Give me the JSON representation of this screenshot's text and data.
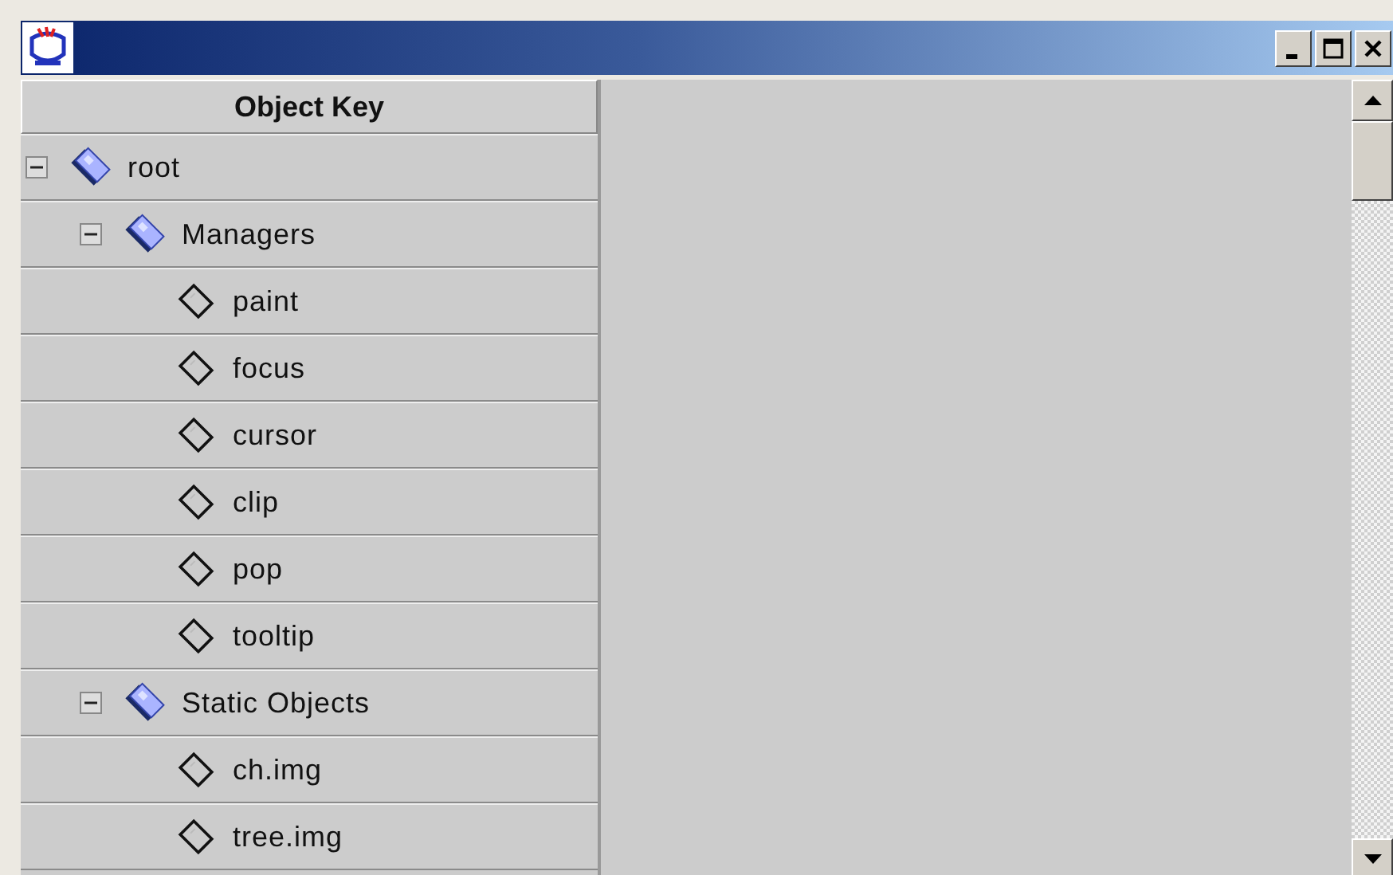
{
  "table": {
    "column_header": "Object Key"
  },
  "tree": [
    {
      "label": "root",
      "expanded": true,
      "children": [
        {
          "label": "Managers",
          "expanded": true,
          "children": [
            {
              "label": "paint"
            },
            {
              "label": "focus"
            },
            {
              "label": "cursor"
            },
            {
              "label": "clip"
            },
            {
              "label": "pop"
            },
            {
              "label": "tooltip"
            }
          ]
        },
        {
          "label": "Static Objects",
          "expanded": true,
          "children": [
            {
              "label": "ch.img"
            },
            {
              "label": "tree.img"
            }
          ]
        }
      ]
    }
  ]
}
